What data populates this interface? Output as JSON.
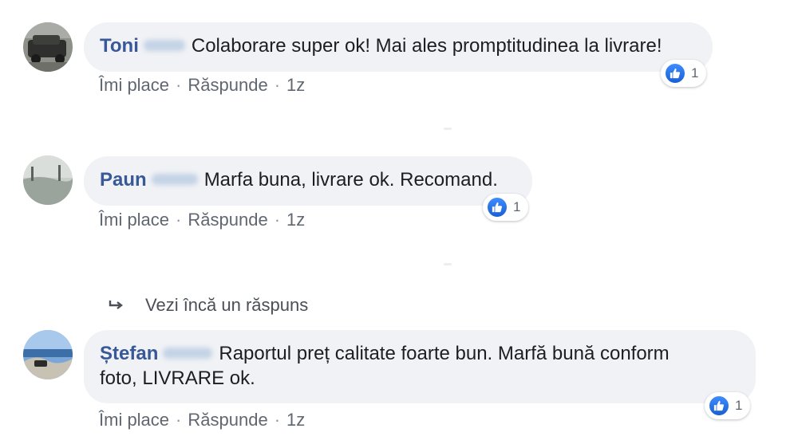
{
  "comments": [
    {
      "author": "Toni",
      "text": "Colaborare super ok! Mai ales promptitudinea la livrare!",
      "actions": {
        "like": "Îmi place",
        "reply": "Răspunde",
        "time": "1z"
      },
      "reaction_count": "1"
    },
    {
      "author": "Paun",
      "text": "Marfa buna, livrare ok. Recomand.",
      "actions": {
        "like": "Îmi place",
        "reply": "Răspunde",
        "time": "1z"
      },
      "reaction_count": "1"
    },
    {
      "author": "Ștefan",
      "text_line1": "Raportul preț calitate foarte bun. Marfă bună conform",
      "text_line2": "foto, LIVRARE ok.",
      "actions": {
        "like": "Îmi place",
        "reply": "Răspunde",
        "time": "1z"
      },
      "reaction_count": "1"
    }
  ],
  "more_replies_label": "Vezi încă un răspuns",
  "separator": "·",
  "icons": {
    "reaction": "like-thumbs-up-icon",
    "more_replies": "reply-arrow-icon"
  },
  "colors": {
    "author": "#385898",
    "bubble": "#f0f2f5",
    "like_blue": "#1a5fd4",
    "meta": "#606770"
  }
}
